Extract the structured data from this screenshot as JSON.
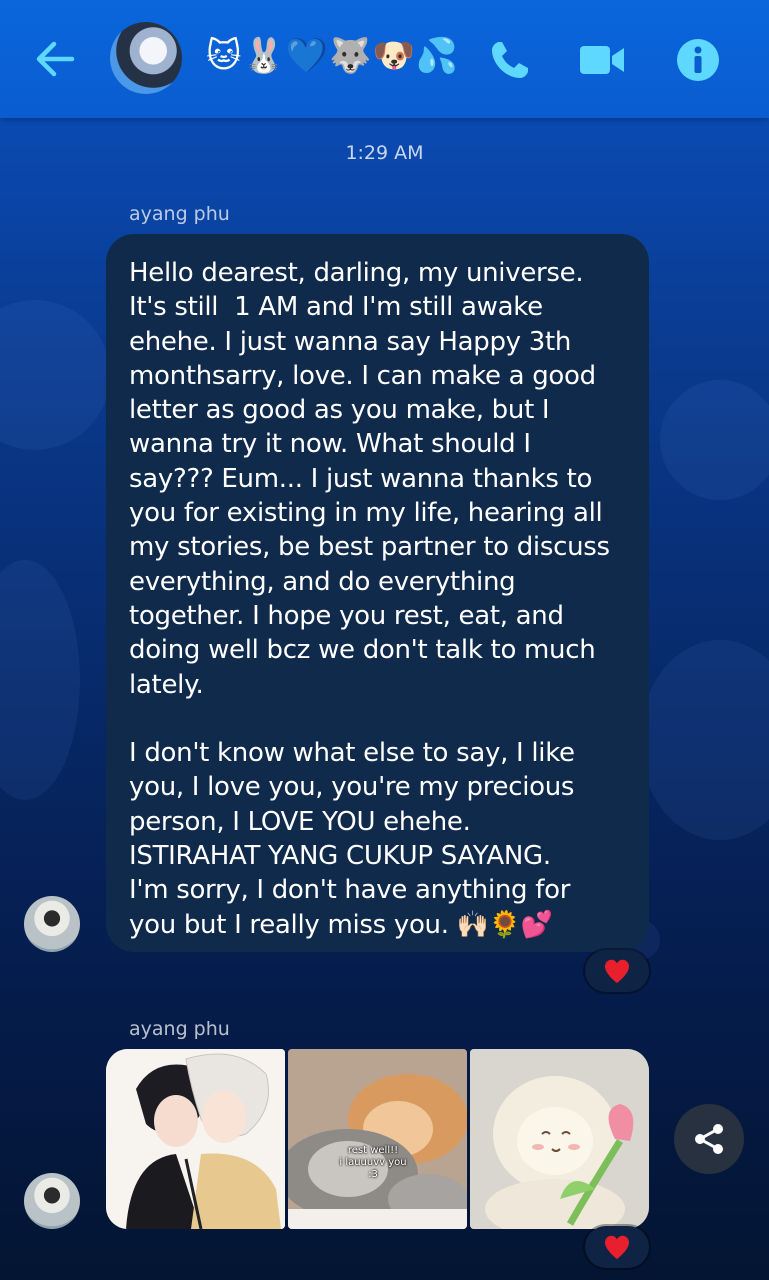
{
  "header": {
    "chat_title": "🐱🐰💙🐺🐶💦",
    "icons": [
      "back-arrow-icon",
      "phone-icon",
      "video-camera-icon",
      "info-icon"
    ],
    "accent_color": "#0a66dc",
    "icon_color": "#5fd8ff"
  },
  "conversation": {
    "timestamp": "1:29 AM",
    "messages": [
      {
        "sender": "ayang phu",
        "text": "Hello dearest, darling, my universe.\nIt's still  1 AM and I'm still awake\nehehe. I just wanna say Happy 3th\nmonthsarry, love. I can make a good\nletter as good as you make, but I\nwanna try it now. What should I\nsay??? Eum... I just wanna thanks to\nyou for existing in my life, hearing all\nmy stories, be best partner to discuss\neverything, and do everything\ntogether. I hope you rest, eat, and\ndoing well bcz we don't talk to much\nlately.\n\nI don't know what else to say, I like\nyou, I love you, you're my precious\nperson, I LOVE YOU ehehe.\nISTIRAHAT YANG CUKUP SAYANG.\nI'm sorry, I don't have anything for\nyou but I really miss you. 🙌🏻🌻💕",
        "reaction": "heart"
      },
      {
        "sender": "ayang phu",
        "photos": [
          {
            "subject": "anime-couple-illustration"
          },
          {
            "subject": "sleeping-kittens",
            "caption": "rest well!!\ni lauuuvv you :3"
          },
          {
            "subject": "plush-sheep-with-tulip"
          }
        ],
        "reaction": "heart"
      }
    ]
  },
  "actions": {
    "share_icon": "share-icon"
  },
  "colors": {
    "bubble": "#102a4c",
    "reaction_heart": "#e8202e"
  }
}
